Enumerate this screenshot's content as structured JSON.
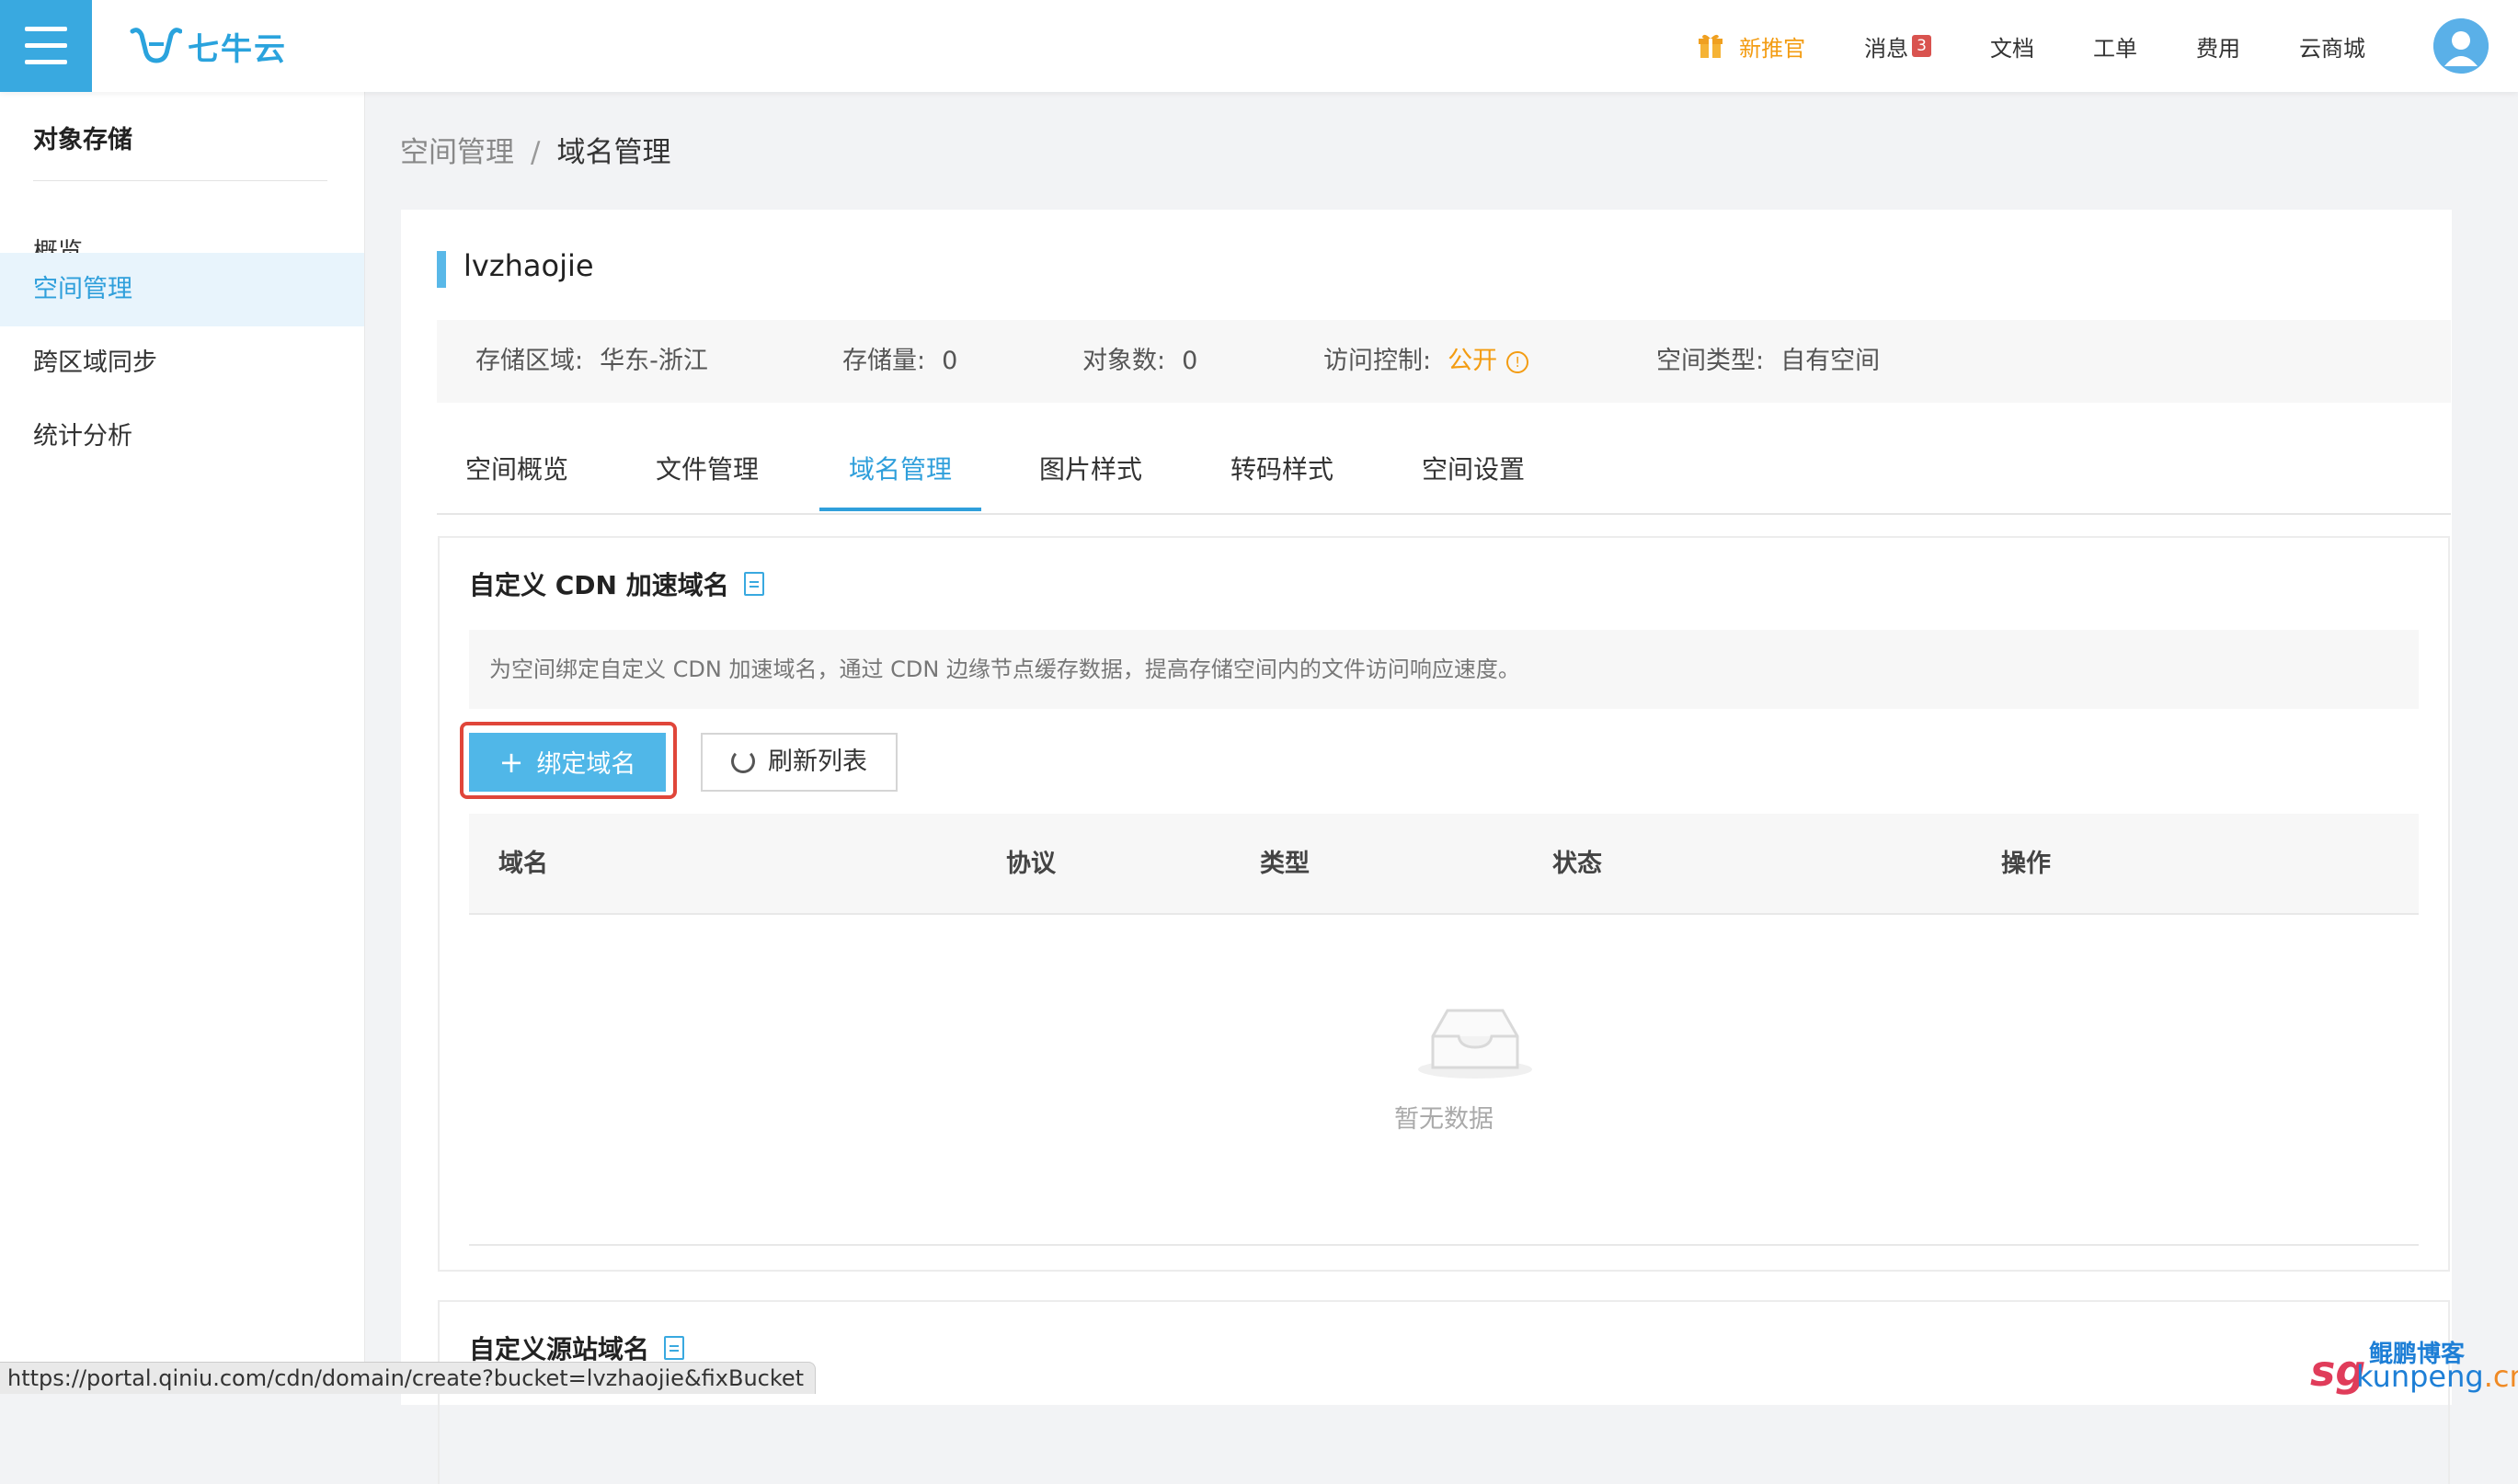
{
  "header": {
    "logo_text": "七牛云",
    "nav": {
      "promo": "新推官",
      "messages": "消息",
      "messages_badge": "3",
      "docs": "文档",
      "tickets": "工单",
      "billing": "费用",
      "marketplace": "云商城"
    }
  },
  "sidebar": {
    "title": "对象存储",
    "items": [
      {
        "label": "概览"
      },
      {
        "label": "空间管理"
      },
      {
        "label": "跨区域同步"
      },
      {
        "label": "统计分析"
      }
    ]
  },
  "breadcrumb": {
    "parent": "空间管理",
    "separator": "/",
    "current": "域名管理"
  },
  "bucket": {
    "name": "lvzhaojie",
    "info": {
      "region_label": "存储区域:",
      "region_value": "华东-浙江",
      "storage_label": "存储量:",
      "storage_value": "0",
      "objects_label": "对象数:",
      "objects_value": "0",
      "access_label": "访问控制:",
      "access_value": "公开",
      "type_label": "空间类型:",
      "type_value": "自有空间"
    }
  },
  "tabs": [
    {
      "label": "空间概览"
    },
    {
      "label": "文件管理"
    },
    {
      "label": "域名管理"
    },
    {
      "label": "图片样式"
    },
    {
      "label": "转码样式"
    },
    {
      "label": "空间设置"
    }
  ],
  "cdn_panel": {
    "title": "自定义 CDN 加速域名",
    "hint": "为空间绑定自定义 CDN 加速域名，通过 CDN 边缘节点缓存数据，提高存储空间内的文件访问响应速度。",
    "bind_button": "绑定域名",
    "refresh_button": "刷新列表",
    "columns": [
      "域名",
      "协议",
      "类型",
      "状态",
      "操作"
    ],
    "empty_text": "暂无数据"
  },
  "origin_panel": {
    "title": "自定义源站域名"
  },
  "status_url": "https://portal.qiniu.com/cdn/domain/create?bucket=lvzhaojie&fixBucket",
  "watermark": {
    "sg": "sg",
    "top": "鲲鹏博客",
    "bottom_main": "kunpeng",
    "bottom_tld": ".cn"
  },
  "colors": {
    "accent": "#2f9fdb",
    "menu_button": "#39a9e0",
    "warning": "#f39c12",
    "highlight_box": "#e0463a"
  }
}
